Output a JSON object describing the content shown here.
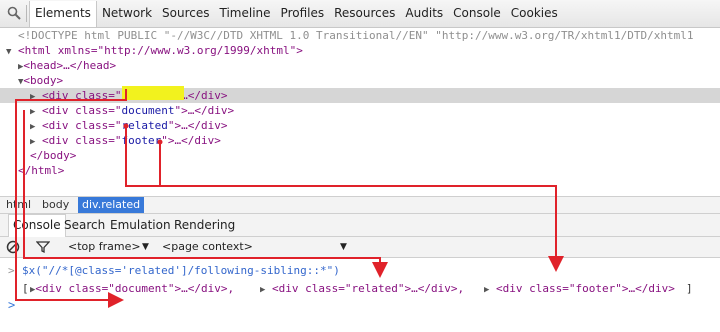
{
  "toolbar": {
    "tabs": [
      "Elements",
      "Network",
      "Sources",
      "Timeline",
      "Profiles",
      "Resources",
      "Audits",
      "Console",
      "Cookies"
    ],
    "active_tab": "Elements"
  },
  "dom": {
    "doctype": "<!DOCTYPE html PUBLIC \"-//W3C//DTD XHTML 1.0 Transitional//EN\" \"http://www.w3.org/TR/xhtml1/DTD/xhtml1",
    "html_open": "<html xmlns=\"http://www.w3.org/1999/xhtml\">",
    "head": "<head>…</head>",
    "body_open": "<body>",
    "children": [
      {
        "class": "related",
        "selected": true
      },
      {
        "class": "document",
        "selected": false
      },
      {
        "class": "related",
        "selected": false
      },
      {
        "class": "footer",
        "selected": false
      }
    ],
    "div_prefix": "<div class=\"",
    "div_suffix": "\">…</div>",
    "body_close": "</body>",
    "html_close": "</html>"
  },
  "breadcrumbs": [
    "html",
    "body",
    "div.related"
  ],
  "drawer": {
    "tabs": [
      "Console",
      "Search",
      "Emulation",
      "Rendering"
    ],
    "active_tab": "Console"
  },
  "console_toolbar": {
    "frame_select": "<top frame>",
    "context_select": "<page context>"
  },
  "console": {
    "command": "$x(\"//*[@class='related']/following-sibling::*\")",
    "result": {
      "open": "[",
      "items": [
        "<div class=\"document\">…</div>,",
        "<div class=\"related\">…</div>,",
        "<div class=\"footer\">…</div>"
      ],
      "close": "]"
    },
    "prompt": ">"
  },
  "colors": {
    "annotation_red": "#e0222a",
    "highlight_yellow": "#f2f21e",
    "selection_blue": "#3879d9"
  }
}
